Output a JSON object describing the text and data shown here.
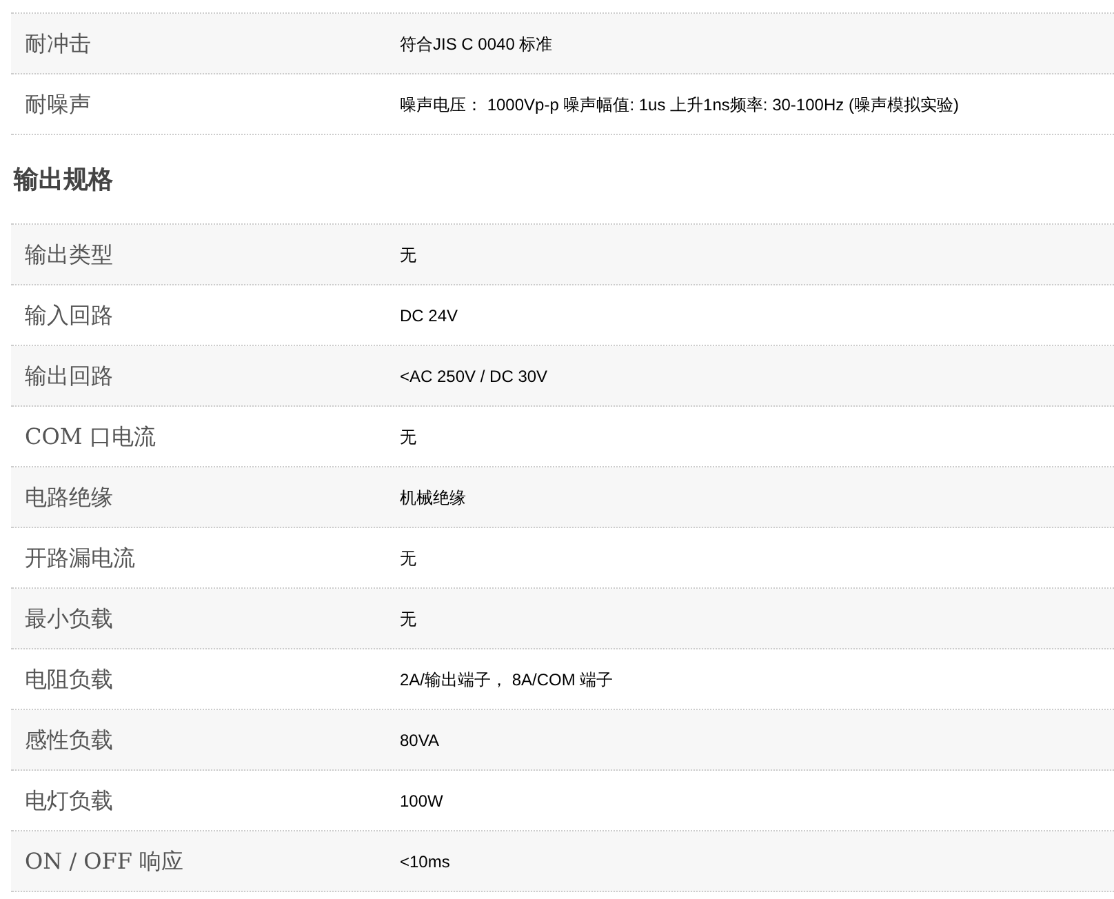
{
  "top_table": {
    "rows": [
      {
        "label": "耐冲击",
        "value": "符合JIS C 0040 标准"
      },
      {
        "label": "耐噪声",
        "value": "噪声电压： 1000Vp-p 噪声幅值: 1us 上升1ns频率: 30-100Hz (噪声模拟实验)"
      }
    ]
  },
  "output_spec": {
    "title": "输出规格",
    "rows": [
      {
        "label": "输出类型",
        "value": "无"
      },
      {
        "label": "输入回路",
        "value": "DC 24V"
      },
      {
        "label": "输出回路",
        "value": "<AC 250V / DC 30V"
      },
      {
        "label": "COM 口电流",
        "value": "无"
      },
      {
        "label": "电路绝缘",
        "value": "机械绝缘"
      },
      {
        "label": "开路漏电流",
        "value": "无"
      },
      {
        "label": "最小负载",
        "value": "无"
      },
      {
        "label": "电阻负载",
        "value": "2A/输出端子， 8A/COM 端子"
      },
      {
        "label": "感性负载",
        "value": "80VA"
      },
      {
        "label": "电灯负载",
        "value": "100W"
      },
      {
        "label": "ON / OFF 响应",
        "value": "<10ms"
      }
    ]
  }
}
